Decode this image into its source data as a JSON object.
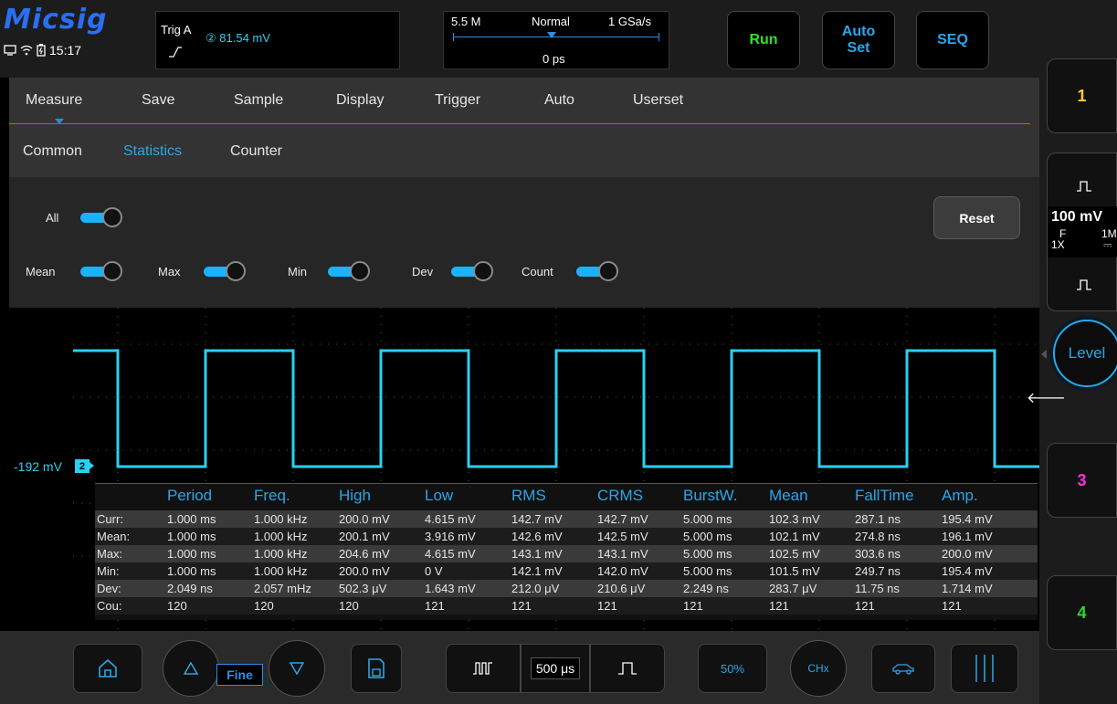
{
  "brand": "Micsig",
  "status": {
    "time": "15:17"
  },
  "trigger": {
    "label": "Trig  A",
    "level": "② 81.54  mV"
  },
  "acquisition": {
    "memory": "5.5 M",
    "mode": "Normal",
    "sample_rate": "1 GSa/s",
    "delay": "0 ps"
  },
  "top_buttons": {
    "run": "Run",
    "autoset_line1": "Auto",
    "autoset_line2": "Set",
    "seq": "SEQ"
  },
  "menu": {
    "tabs": [
      "Measure",
      "Save",
      "Sample",
      "Display",
      "Trigger",
      "Auto",
      "Userset"
    ],
    "subtabs": [
      "Common",
      "Statistics",
      "Counter"
    ],
    "active_subtab": "Statistics",
    "toggles": {
      "all": "All",
      "mean": "Mean",
      "max": "Max",
      "min": "Min",
      "dev": "Dev",
      "count": "Count"
    },
    "reset": "Reset"
  },
  "channels": {
    "ch1": "1",
    "ch2_scale": "100 mV",
    "ch2_coupling": "F",
    "ch2_impedance": "1M",
    "ch2_probe": "1X",
    "ch3": "3",
    "ch4": "4",
    "level": "Level"
  },
  "waveform": {
    "offset": "-192 mV",
    "channel_tag": "2"
  },
  "stats": {
    "columns": [
      "Period",
      "Freq.",
      "High",
      "Low",
      "RMS",
      "CRMS",
      "BurstW.",
      "Mean",
      "FallTime",
      "Amp."
    ],
    "rows": [
      {
        "label": "Curr:",
        "values": [
          "1.000 ms",
          "1.000 kHz",
          "200.0 mV",
          "4.615 mV",
          "142.7 mV",
          "142.7 mV",
          "5.000 ms",
          "102.3 mV",
          "287.1 ns",
          "195.4 mV"
        ]
      },
      {
        "label": "Mean:",
        "values": [
          "1.000 ms",
          "1.000 kHz",
          "200.1 mV",
          "3.916 mV",
          "142.6 mV",
          "142.5 mV",
          "5.000 ms",
          "102.1 mV",
          "274.8 ns",
          "196.1 mV"
        ]
      },
      {
        "label": "Max:",
        "values": [
          "1.000 ms",
          "1.000 kHz",
          "204.6 mV",
          "4.615 mV",
          "143.1 mV",
          "143.1 mV",
          "5.000 ms",
          "102.5 mV",
          "303.6 ns",
          "200.0 mV"
        ]
      },
      {
        "label": "Min:",
        "values": [
          "1.000 ms",
          "1.000 kHz",
          "200.0 mV",
          "0 V",
          "142.1 mV",
          "142.0 mV",
          "5.000 ms",
          "101.5 mV",
          "249.7 ns",
          "195.4 mV"
        ]
      },
      {
        "label": "Dev:",
        "values": [
          "2.049 ns",
          "2.057 mHz",
          "502.3 μV",
          "1.643 mV",
          "212.0 μV",
          "210.6 μV",
          "2.249 ns",
          "283.7 μV",
          "11.75 ns",
          "1.714 mV"
        ]
      },
      {
        "label": "Cou:",
        "values": [
          "120",
          "120",
          "120",
          "121",
          "121",
          "121",
          "121",
          "121",
          "121",
          "121"
        ]
      }
    ]
  },
  "bottom": {
    "fine": "Fine",
    "timebase": "500 μs",
    "fifty": "50%",
    "chx": "CHx"
  },
  "colors": {
    "accent": "#2aa6ea",
    "ch1": "#ffd21f",
    "ch2": "#2ad0f2",
    "ch3": "#ff2de0",
    "ch4": "#34d431",
    "run": "#33e02b"
  }
}
